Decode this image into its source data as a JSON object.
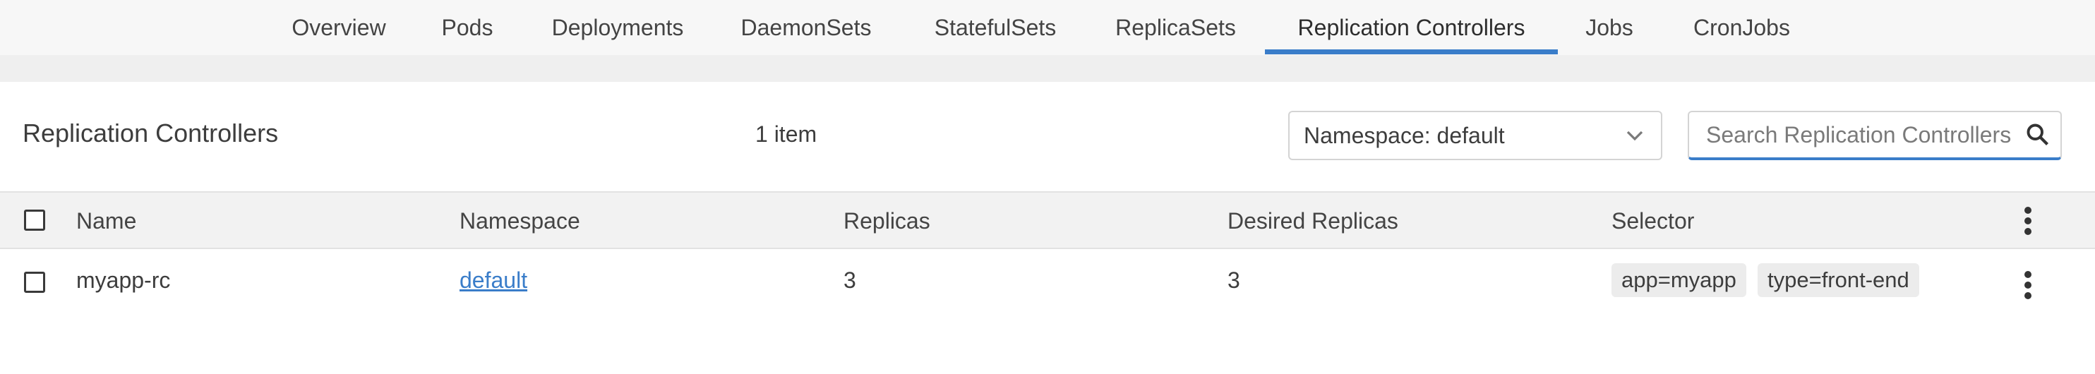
{
  "tabs": [
    {
      "label": "Overview"
    },
    {
      "label": "Pods"
    },
    {
      "label": "Deployments"
    },
    {
      "label": "DaemonSets"
    },
    {
      "label": "StatefulSets"
    },
    {
      "label": "ReplicaSets"
    },
    {
      "label": "Replication Controllers",
      "active": true
    },
    {
      "label": "Jobs"
    },
    {
      "label": "CronJobs"
    }
  ],
  "header": {
    "title": "Replication Controllers",
    "count": "1 item",
    "namespace_select": "Namespace: default",
    "search_placeholder": "Search Replication Controllers"
  },
  "table": {
    "columns": [
      "Name",
      "Namespace",
      "Replicas",
      "Desired Replicas",
      "Selector"
    ],
    "rows": [
      {
        "name": "myapp-rc",
        "namespace": "default",
        "replicas": "3",
        "desired_replicas": "3",
        "selector": [
          "app=myapp",
          "type=front-end"
        ]
      }
    ]
  },
  "colors": {
    "accent": "#3a7dc9",
    "tab_bar_bg": "#f7f7f7",
    "header_bg": "#f2f2f2",
    "chip_bg": "#ececec"
  },
  "icons": {
    "search": "search-icon",
    "chevron": "chevron-down-icon",
    "kebab": "kebab-menu-icon"
  }
}
